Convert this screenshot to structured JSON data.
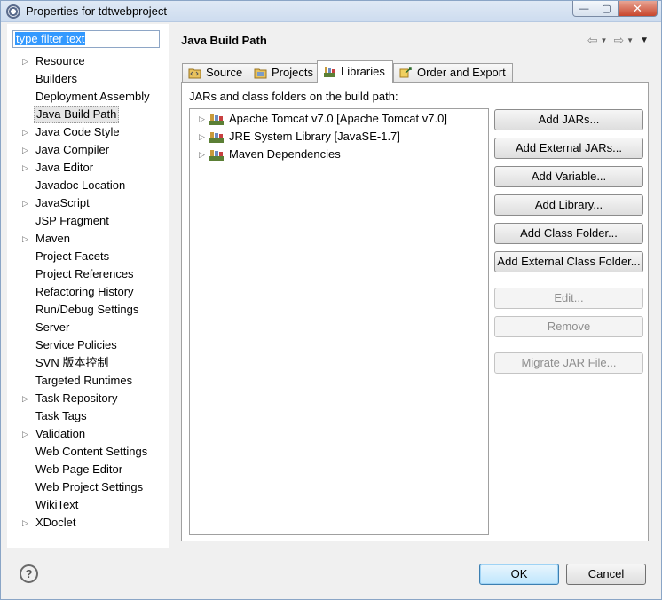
{
  "window": {
    "title": "Properties for tdtwebproject",
    "min_icon": "minimize-icon",
    "max_icon": "maximize-icon",
    "close_icon": "close-icon"
  },
  "filter": {
    "value": "type filter text"
  },
  "tree": [
    {
      "label": "Resource",
      "expandable": true
    },
    {
      "label": "Builders",
      "expandable": false
    },
    {
      "label": "Deployment Assembly",
      "expandable": false
    },
    {
      "label": "Java Build Path",
      "expandable": false,
      "selected": true
    },
    {
      "label": "Java Code Style",
      "expandable": true
    },
    {
      "label": "Java Compiler",
      "expandable": true
    },
    {
      "label": "Java Editor",
      "expandable": true
    },
    {
      "label": "Javadoc Location",
      "expandable": false
    },
    {
      "label": "JavaScript",
      "expandable": true
    },
    {
      "label": "JSP Fragment",
      "expandable": false
    },
    {
      "label": "Maven",
      "expandable": true
    },
    {
      "label": "Project Facets",
      "expandable": false
    },
    {
      "label": "Project References",
      "expandable": false
    },
    {
      "label": "Refactoring History",
      "expandable": false
    },
    {
      "label": "Run/Debug Settings",
      "expandable": false
    },
    {
      "label": "Server",
      "expandable": false
    },
    {
      "label": "Service Policies",
      "expandable": false
    },
    {
      "label": "SVN 版本控制",
      "expandable": false
    },
    {
      "label": "Targeted Runtimes",
      "expandable": false
    },
    {
      "label": "Task Repository",
      "expandable": true
    },
    {
      "label": "Task Tags",
      "expandable": false
    },
    {
      "label": "Validation",
      "expandable": true
    },
    {
      "label": "Web Content Settings",
      "expandable": false
    },
    {
      "label": "Web Page Editor",
      "expandable": false
    },
    {
      "label": "Web Project Settings",
      "expandable": false
    },
    {
      "label": "WikiText",
      "expandable": false
    },
    {
      "label": "XDoclet",
      "expandable": true
    }
  ],
  "page": {
    "title": "Java Build Path"
  },
  "tabs": [
    {
      "label": "Source",
      "icon": "source-folder-icon"
    },
    {
      "label": "Projects",
      "icon": "projects-icon"
    },
    {
      "label": "Libraries",
      "icon": "libraries-icon",
      "active": true
    },
    {
      "label": "Order and Export",
      "icon": "order-export-icon"
    }
  ],
  "libraries": {
    "description": "JARs and class folders on the build path:",
    "items": [
      {
        "label": "Apache Tomcat v7.0 [Apache Tomcat v7.0]"
      },
      {
        "label": "JRE System Library [JavaSE-1.7]"
      },
      {
        "label": "Maven Dependencies"
      }
    ]
  },
  "buttons": [
    {
      "label": "Add JARs...",
      "enabled": true
    },
    {
      "label": "Add External JARs...",
      "enabled": true
    },
    {
      "label": "Add Variable...",
      "enabled": true
    },
    {
      "label": "Add Library...",
      "enabled": true
    },
    {
      "label": "Add Class Folder...",
      "enabled": true
    },
    {
      "label": "Add External Class Folder...",
      "enabled": true
    },
    {
      "label": "Edit...",
      "enabled": false
    },
    {
      "label": "Remove",
      "enabled": false
    },
    {
      "label": "Migrate JAR File...",
      "enabled": false
    }
  ],
  "footer": {
    "help": "?",
    "ok": "OK",
    "cancel": "Cancel"
  },
  "colors": {
    "selection": "#3399ff",
    "window_frame": "#8aa5c6",
    "default_button": "#3c7fb1"
  }
}
